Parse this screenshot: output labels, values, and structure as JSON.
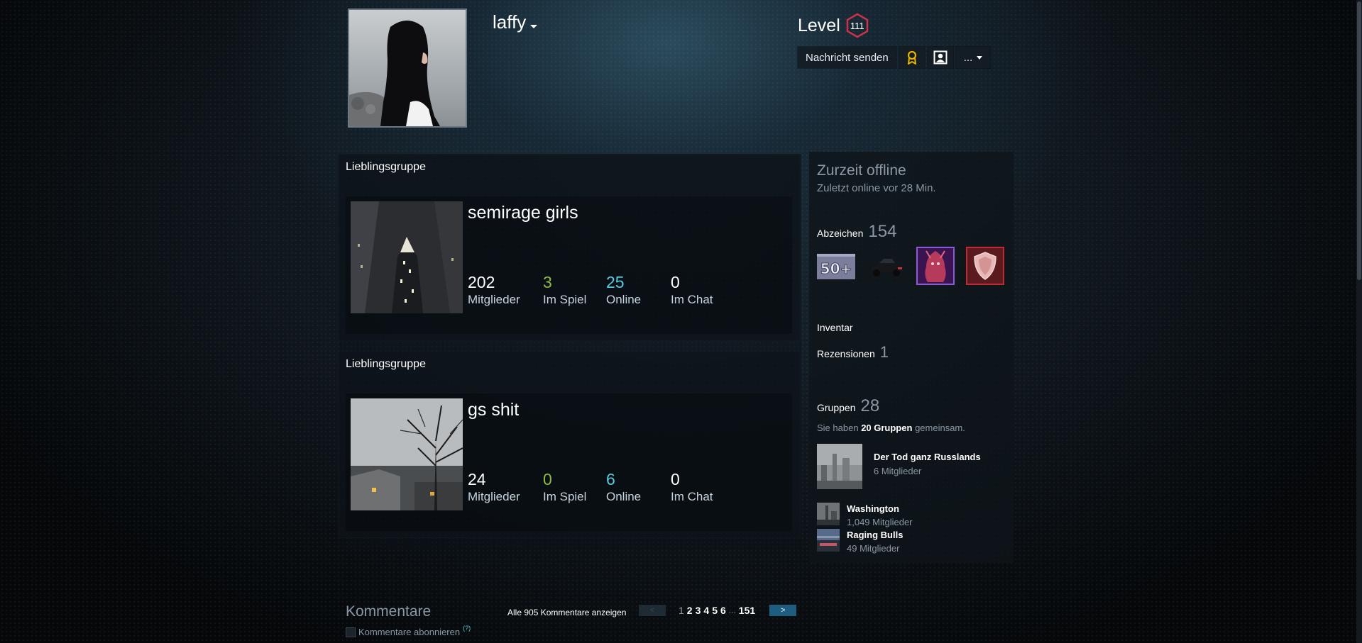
{
  "profile": {
    "persona_name": "laffy",
    "level_label": "Level",
    "level_value": "111"
  },
  "actions": {
    "send_message": "Nachricht senden",
    "more": "..."
  },
  "showcases": [
    {
      "title": "Lieblingsgruppe",
      "group_name": "semirage girls",
      "stats": [
        {
          "value": "202",
          "label": "Mitglieder"
        },
        {
          "value": "3",
          "label": "Im Spiel"
        },
        {
          "value": "25",
          "label": "Online"
        },
        {
          "value": "0",
          "label": "Im Chat"
        }
      ]
    },
    {
      "title": "Lieblingsgruppe",
      "group_name": "gs shit",
      "stats": [
        {
          "value": "24",
          "label": "Mitglieder"
        },
        {
          "value": "0",
          "label": "Im Spiel"
        },
        {
          "value": "6",
          "label": "Online"
        },
        {
          "value": "0",
          "label": "Im Chat"
        }
      ]
    }
  ],
  "comments": {
    "title": "Kommentare",
    "subscribe_label": "Kommentare abonnieren",
    "help": "(?)",
    "view_all": "Alle 905 Kommentare anzeigen",
    "pagination": {
      "prev": "<",
      "next": ">",
      "current": "1",
      "pages": [
        "2",
        "3",
        "4",
        "5",
        "6"
      ],
      "ellipsis": "...",
      "last": "151"
    }
  },
  "sidebar": {
    "status": "Zurzeit offline",
    "last_online": "Zuletzt online vor 28 Min.",
    "badges_label": "Abzeichen",
    "badges_count": "154",
    "badge_50_text": "50+",
    "inventory_label": "Inventar",
    "reviews_label": "Rezensionen",
    "reviews_count": "1",
    "groups_label": "Gruppen",
    "groups_count": "28",
    "groups_common_prefix": "Sie haben",
    "groups_common_bold": "20 Gruppen",
    "groups_common_suffix": "gemeinsam.",
    "groups": [
      {
        "name": "Der Tod ganz Russlands",
        "members": "6 Mitglieder"
      },
      {
        "name": "Washington",
        "members": "1,049 Mitglieder"
      },
      {
        "name": "Raging Bulls",
        "members": "49 Mitglieder"
      }
    ]
  },
  "colors": {
    "accent_green": "#90ba3c",
    "accent_blue": "#57cbde",
    "level_ring": "#c8324a",
    "next_button": "#1f5d80"
  }
}
